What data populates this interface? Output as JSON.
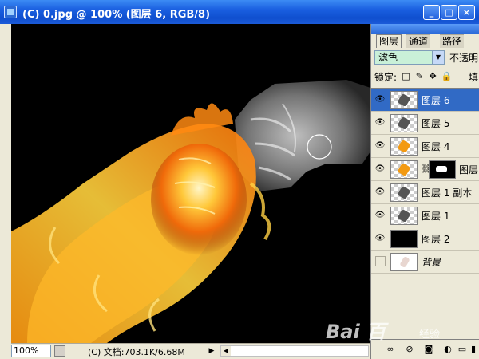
{
  "window": {
    "title": "(C) 0.jpg @ 100% (图层 6, RGB/8)",
    "buttons": {
      "minimize": "_",
      "maximize": "□",
      "close": "×"
    }
  },
  "status": {
    "zoom": "100%",
    "doc_info": "(C) 文档:703.1K/6.68M",
    "arrow": "▶",
    "scroll_arrow": "◀"
  },
  "layers_panel": {
    "tabs": [
      {
        "label": "图层",
        "active": true
      },
      {
        "label": "通道",
        "active": false
      },
      {
        "label": "路径",
        "active": false
      }
    ],
    "blend_mode": "滤色",
    "opacity_label": "不透明",
    "lock_label": "锁定:",
    "lock_icons": [
      "□",
      "✎",
      "✥",
      "🔒"
    ],
    "fill_label": "填",
    "layers": [
      {
        "name": "图层 6",
        "visible": true,
        "selected": true,
        "thumb": "hand-cutout"
      },
      {
        "name": "图层 5",
        "visible": true,
        "selected": false,
        "thumb": "hand-cutout"
      },
      {
        "name": "图层 4",
        "visible": true,
        "selected": false,
        "thumb": "fire"
      },
      {
        "name": "图层",
        "visible": true,
        "selected": false,
        "thumb": "fire-with-mask",
        "has_mask": true
      },
      {
        "name": "图层 1 副本",
        "visible": true,
        "selected": false,
        "thumb": "hand"
      },
      {
        "name": "图层 1",
        "visible": true,
        "selected": false,
        "thumb": "hand"
      },
      {
        "name": "图层 2",
        "visible": true,
        "selected": false,
        "thumb": "black-fill"
      },
      {
        "name": "背景",
        "visible": false,
        "selected": false,
        "thumb": "background",
        "italic": true
      }
    ],
    "bottom_buttons": [
      "∞",
      "⊘",
      "◙",
      "◐",
      "▭",
      "▮"
    ]
  },
  "watermark": {
    "text": "Bai 百",
    "sub": "经验"
  }
}
